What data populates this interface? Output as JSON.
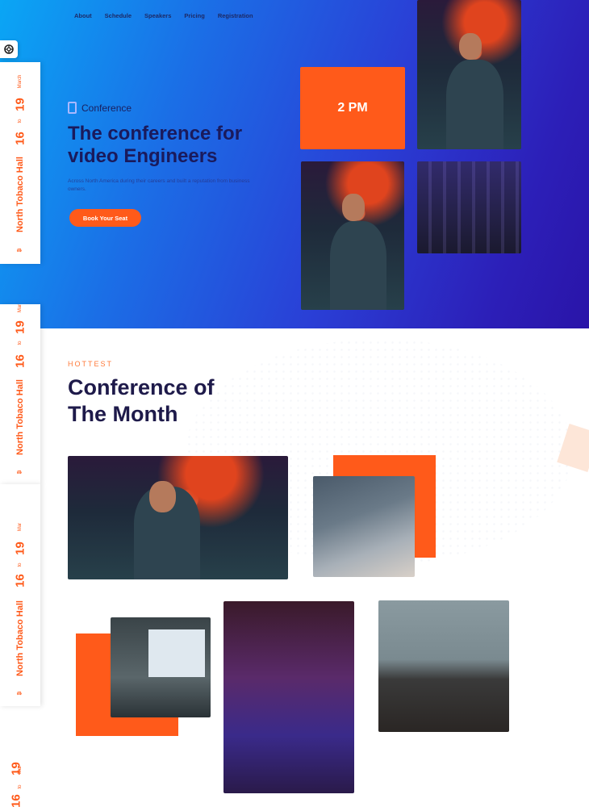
{
  "nav": {
    "items": [
      "About",
      "Schedule",
      "Speakers",
      "Pricing",
      "Registration"
    ]
  },
  "hero": {
    "logo_text": "Conference",
    "title": "The conference for video Engineers",
    "subtitle": "Across North America during their careers and built a reputation from business owners.",
    "cta": "Book Your Seat",
    "time_tile": "2 PM"
  },
  "sidebar": {
    "venue": "North Tobaco Hall",
    "start_day": "16",
    "to": "to",
    "end_day": "19",
    "month": "March",
    "month_short": "Mar",
    "marker": "₿"
  },
  "section": {
    "eyebrow": "HOTTEST",
    "title_line1": "Conference of",
    "title_line2": "The Month"
  },
  "colors": {
    "accent": "#ff5a1a",
    "navy": "#1e1a4a",
    "hero_start": "#0aa6f5",
    "hero_end": "#2a14a8"
  },
  "icons": {
    "sidebar_top": "lifebuoy-icon"
  }
}
